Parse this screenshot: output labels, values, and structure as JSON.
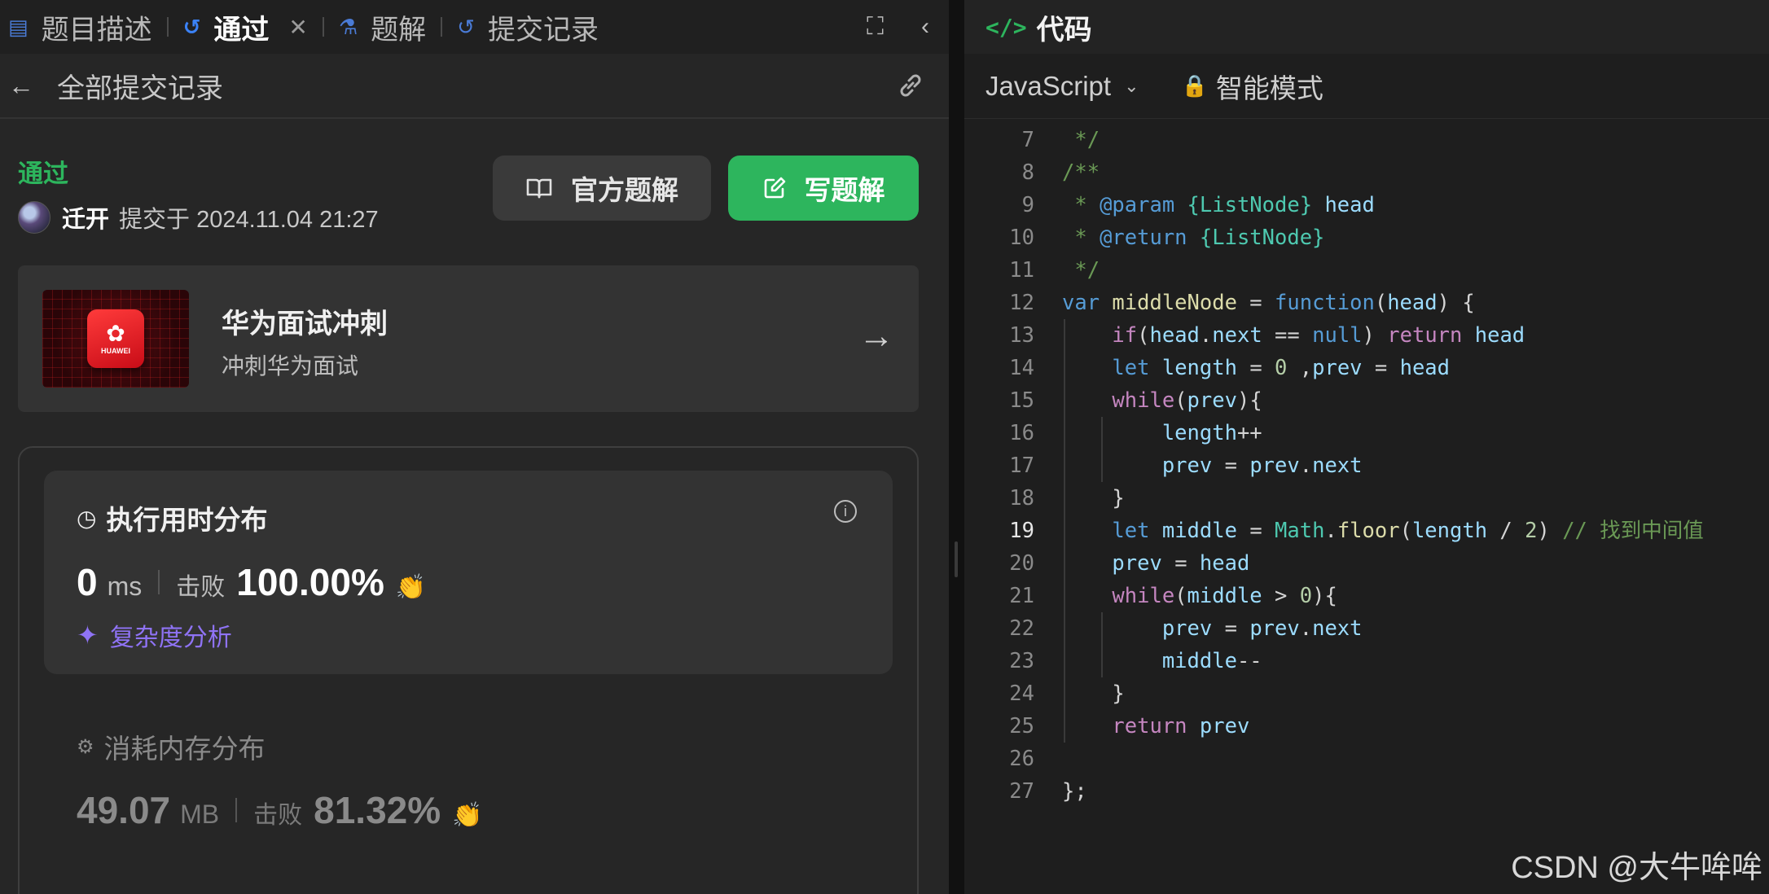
{
  "left_tabs": {
    "description": "题目描述",
    "passed": "通过",
    "solutions": "题解",
    "submissions": "提交记录"
  },
  "subheader": {
    "title": "全部提交记录"
  },
  "result": {
    "status": "通过",
    "author": "迁开",
    "submitted_label": "提交于 2024.11.04 21:27"
  },
  "buttons": {
    "official": "官方题解",
    "write": "写题解"
  },
  "promo": {
    "title": "华为面试冲刺",
    "subtitle": "冲刺华为面试",
    "logo_text": "HUAWEI"
  },
  "runtime": {
    "title": "执行用时分布",
    "value": "0",
    "unit": "ms",
    "beat_label": "击败",
    "percent": "100.00%",
    "complexity_link": "复杂度分析"
  },
  "memory": {
    "title": "消耗内存分布",
    "value": "49.07",
    "unit": "MB",
    "beat_label": "击败",
    "percent": "81.32%"
  },
  "code_panel": {
    "title": "代码",
    "language": "JavaScript",
    "mode": "智能模式"
  },
  "code_lines": [
    {
      "n": "7",
      "tokens": [
        [
          "t-comment",
          " */"
        ]
      ]
    },
    {
      "n": "8",
      "tokens": [
        [
          "t-comment",
          "/**"
        ]
      ]
    },
    {
      "n": "9",
      "tokens": [
        [
          "t-comment",
          " * "
        ],
        [
          "t-tag",
          "@param"
        ],
        [
          "t-comment",
          " "
        ],
        [
          "t-type",
          "{ListNode}"
        ],
        [
          "t-comment",
          " "
        ],
        [
          "t-param",
          "head"
        ]
      ]
    },
    {
      "n": "10",
      "tokens": [
        [
          "t-comment",
          " * "
        ],
        [
          "t-tag",
          "@return"
        ],
        [
          "t-comment",
          " "
        ],
        [
          "t-type",
          "{ListNode}"
        ]
      ]
    },
    {
      "n": "11",
      "tokens": [
        [
          "t-comment",
          " */"
        ]
      ]
    },
    {
      "n": "12",
      "tokens": [
        [
          "t-keyword",
          "var"
        ],
        [
          "t-plain",
          " "
        ],
        [
          "t-func",
          "middleNode"
        ],
        [
          "t-plain",
          " = "
        ],
        [
          "t-keyword",
          "function"
        ],
        [
          "t-plain",
          "("
        ],
        [
          "t-var",
          "head"
        ],
        [
          "t-plain",
          ") {"
        ]
      ]
    },
    {
      "n": "13",
      "tokens": [
        [
          "t-plain",
          "    "
        ],
        [
          "t-control",
          "if"
        ],
        [
          "t-plain",
          "("
        ],
        [
          "t-var",
          "head"
        ],
        [
          "t-plain",
          "."
        ],
        [
          "t-var",
          "next"
        ],
        [
          "t-plain",
          " == "
        ],
        [
          "t-keyword",
          "null"
        ],
        [
          "t-plain",
          ") "
        ],
        [
          "t-control",
          "return"
        ],
        [
          "t-plain",
          " "
        ],
        [
          "t-var",
          "head"
        ]
      ]
    },
    {
      "n": "14",
      "tokens": [
        [
          "t-plain",
          "    "
        ],
        [
          "t-keyword",
          "let"
        ],
        [
          "t-plain",
          " "
        ],
        [
          "t-var",
          "length"
        ],
        [
          "t-plain",
          " = "
        ],
        [
          "t-num",
          "0"
        ],
        [
          "t-plain",
          " ,"
        ],
        [
          "t-var",
          "prev"
        ],
        [
          "t-plain",
          " = "
        ],
        [
          "t-var",
          "head"
        ]
      ]
    },
    {
      "n": "15",
      "tokens": [
        [
          "t-plain",
          "    "
        ],
        [
          "t-control",
          "while"
        ],
        [
          "t-plain",
          "("
        ],
        [
          "t-var",
          "prev"
        ],
        [
          "t-plain",
          "){"
        ]
      ]
    },
    {
      "n": "16",
      "tokens": [
        [
          "t-plain",
          "        "
        ],
        [
          "t-var",
          "length"
        ],
        [
          "t-plain",
          "++"
        ]
      ]
    },
    {
      "n": "17",
      "tokens": [
        [
          "t-plain",
          "        "
        ],
        [
          "t-var",
          "prev"
        ],
        [
          "t-plain",
          " = "
        ],
        [
          "t-var",
          "prev"
        ],
        [
          "t-plain",
          "."
        ],
        [
          "t-var",
          "next"
        ]
      ]
    },
    {
      "n": "18",
      "tokens": [
        [
          "t-plain",
          "    }"
        ]
      ]
    },
    {
      "n": "19",
      "tokens": [
        [
          "t-plain",
          "    "
        ],
        [
          "t-keyword",
          "let"
        ],
        [
          "t-plain",
          " "
        ],
        [
          "t-var",
          "middle"
        ],
        [
          "t-plain",
          " = "
        ],
        [
          "t-class",
          "Math"
        ],
        [
          "t-plain",
          "."
        ],
        [
          "t-func",
          "floor"
        ],
        [
          "t-plain",
          "("
        ],
        [
          "t-var",
          "length"
        ],
        [
          "t-plain",
          " / "
        ],
        [
          "t-num",
          "2"
        ],
        [
          "t-plain",
          ") "
        ],
        [
          "t-comment",
          "// 找到中间值"
        ]
      ]
    },
    {
      "n": "20",
      "tokens": [
        [
          "t-plain",
          "    "
        ],
        [
          "t-var",
          "prev"
        ],
        [
          "t-plain",
          " = "
        ],
        [
          "t-var",
          "head"
        ]
      ]
    },
    {
      "n": "21",
      "tokens": [
        [
          "t-plain",
          "    "
        ],
        [
          "t-control",
          "while"
        ],
        [
          "t-plain",
          "("
        ],
        [
          "t-var",
          "middle"
        ],
        [
          "t-plain",
          " > "
        ],
        [
          "t-num",
          "0"
        ],
        [
          "t-plain",
          "){"
        ]
      ]
    },
    {
      "n": "22",
      "tokens": [
        [
          "t-plain",
          "        "
        ],
        [
          "t-var",
          "prev"
        ],
        [
          "t-plain",
          " = "
        ],
        [
          "t-var",
          "prev"
        ],
        [
          "t-plain",
          "."
        ],
        [
          "t-var",
          "next"
        ]
      ]
    },
    {
      "n": "23",
      "tokens": [
        [
          "t-plain",
          "        "
        ],
        [
          "t-var",
          "middle"
        ],
        [
          "t-plain",
          "--"
        ]
      ]
    },
    {
      "n": "24",
      "tokens": [
        [
          "t-plain",
          "    }"
        ]
      ]
    },
    {
      "n": "25",
      "tokens": [
        [
          "t-plain",
          "    "
        ],
        [
          "t-control",
          "return"
        ],
        [
          "t-plain",
          " "
        ],
        [
          "t-var",
          "prev"
        ]
      ]
    },
    {
      "n": "26",
      "tokens": [
        [
          "t-plain",
          ""
        ]
      ]
    },
    {
      "n": "27",
      "tokens": [
        [
          "t-plain",
          "};"
        ]
      ]
    }
  ],
  "current_line": "19",
  "watermark": "CSDN @大牛哞哞",
  "colors": {
    "accent_green": "#2db55d",
    "ai_purple": "#8f73f5"
  }
}
